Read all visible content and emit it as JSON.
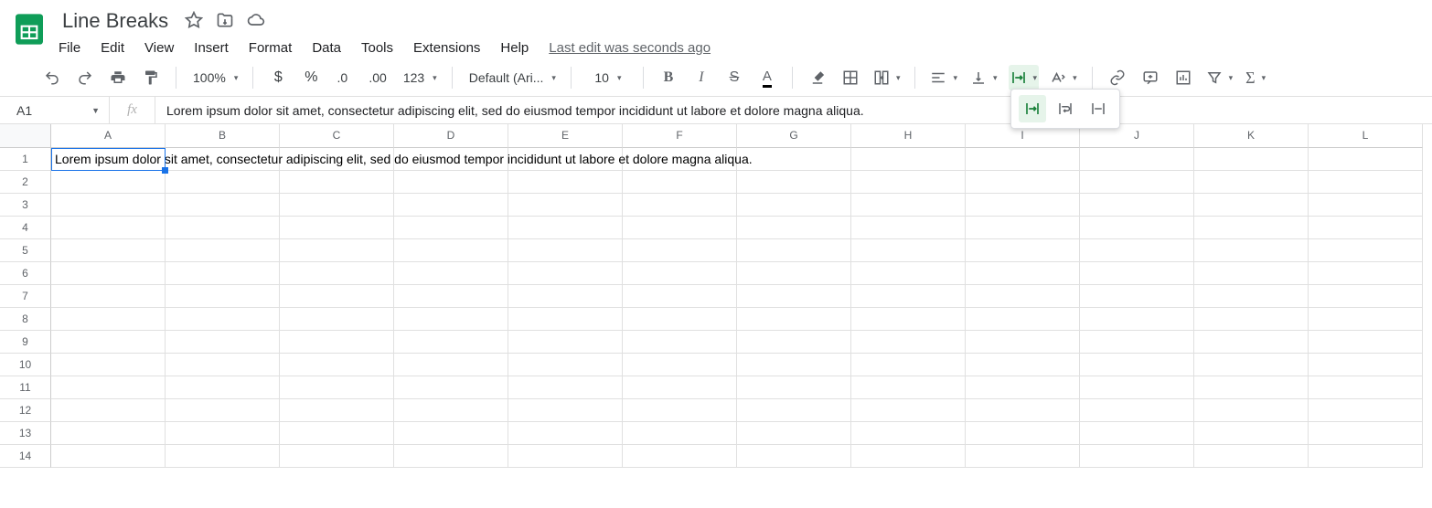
{
  "doc": {
    "title": "Line Breaks"
  },
  "menu": {
    "items": [
      "File",
      "Edit",
      "View",
      "Insert",
      "Format",
      "Data",
      "Tools",
      "Extensions",
      "Help"
    ],
    "last_edit": "Last edit was seconds ago"
  },
  "toolbar": {
    "zoom": "100%",
    "font": "Default (Ari...",
    "font_size": "10",
    "number_format": "123"
  },
  "fx": {
    "cell_ref": "A1",
    "fx_symbol": "fx",
    "formula": "Lorem ipsum dolor sit amet, consectetur adipiscing elit, sed do eiusmod tempor incididunt ut labore et dolore magna aliqua."
  },
  "sheet": {
    "columns": [
      "A",
      "B",
      "C",
      "D",
      "E",
      "F",
      "G",
      "H",
      "I",
      "J",
      "K",
      "L"
    ],
    "rows": [
      1,
      2,
      3,
      4,
      5,
      6,
      7,
      8,
      9,
      10,
      11,
      12,
      13,
      14
    ],
    "A1": "Lorem ipsum dolor sit amet, consectetur adipiscing elit, sed do eiusmod tempor incididunt ut labore et dolore magna aliqua."
  }
}
